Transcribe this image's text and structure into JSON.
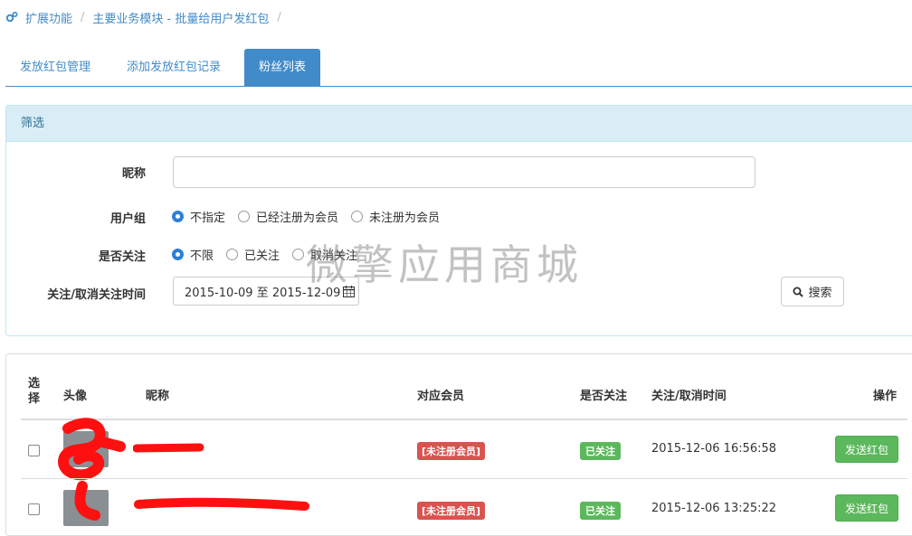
{
  "breadcrumb": {
    "items": [
      "扩展功能",
      "主要业务模块 - 批量给用户发红包"
    ],
    "separator": "/"
  },
  "tabs": [
    {
      "label": "发放红包管理",
      "active": false
    },
    {
      "label": "添加发放红包记录",
      "active": false
    },
    {
      "label": "粉丝列表",
      "active": true
    }
  ],
  "filter": {
    "title": "筛选",
    "nickname_label": "昵称",
    "nickname_value": "",
    "group_label": "用户组",
    "group_options": [
      "不指定",
      "已经注册为会员",
      "未注册为会员"
    ],
    "group_selected": 0,
    "follow_label": "是否关注",
    "follow_options": [
      "不限",
      "已关注",
      "取消关注"
    ],
    "follow_selected": 0,
    "time_label": "关注/取消关注时间",
    "date_range": "2015-10-09 至 2015-12-09",
    "search_label": "搜索"
  },
  "watermark": "微擎应用商城",
  "table": {
    "headers": {
      "select": [
        "选",
        "择"
      ],
      "avatar": "头像",
      "nickname": "昵称",
      "member": "对应会员",
      "followed": "是否关注",
      "time": "关注/取消时间",
      "action": "操作"
    },
    "rows": [
      {
        "member": "[未注册会员]",
        "followed": "已关注",
        "time": "2015-12-06 16:56:58",
        "action": "发送红包"
      },
      {
        "member": "[未注册会员]",
        "followed": "已关注",
        "time": "2015-12-06 13:25:22",
        "action": "发送红包"
      }
    ]
  },
  "colors": {
    "primary": "#428bca",
    "danger": "#d9534f",
    "success": "#5cb85c",
    "info_bg": "#d9edf7"
  }
}
